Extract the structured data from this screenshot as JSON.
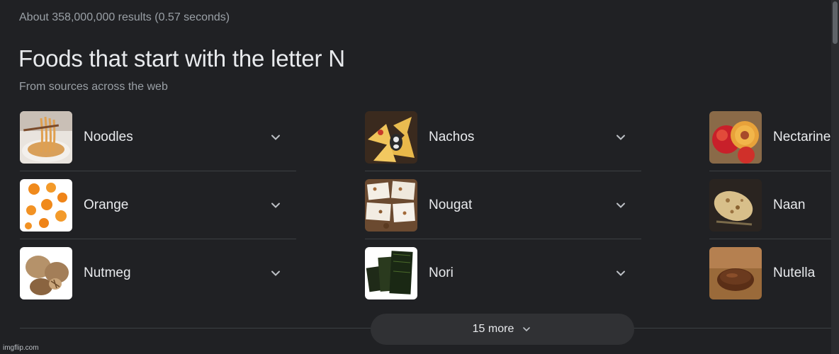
{
  "result_stats": "About 358,000,000 results (0.57 seconds)",
  "title": "Foods that start with the letter N",
  "subtitle": "From sources across the web",
  "columns": [
    [
      {
        "label": "Noodles",
        "image": "noodles-image"
      },
      {
        "label": "Orange",
        "image": "orange-image"
      },
      {
        "label": "Nutmeg",
        "image": "nutmeg-image"
      }
    ],
    [
      {
        "label": "Nachos",
        "image": "nachos-image"
      },
      {
        "label": "Nougat",
        "image": "nougat-image"
      },
      {
        "label": "Nori",
        "image": "nori-image"
      }
    ],
    [
      {
        "label": "Nectarine",
        "image": "nectarine-image"
      },
      {
        "label": "Naan",
        "image": "naan-image"
      },
      {
        "label": "Nutella",
        "image": "nutella-image"
      }
    ]
  ],
  "more_button": "15 more",
  "icons": {
    "expand": "chevron-down-icon"
  },
  "watermark": "imgflip.com",
  "colors": {
    "background": "#202124",
    "text": "#e8eaed",
    "secondary_text": "#9aa0a6",
    "button": "#303134",
    "divider": "#3c4043"
  }
}
